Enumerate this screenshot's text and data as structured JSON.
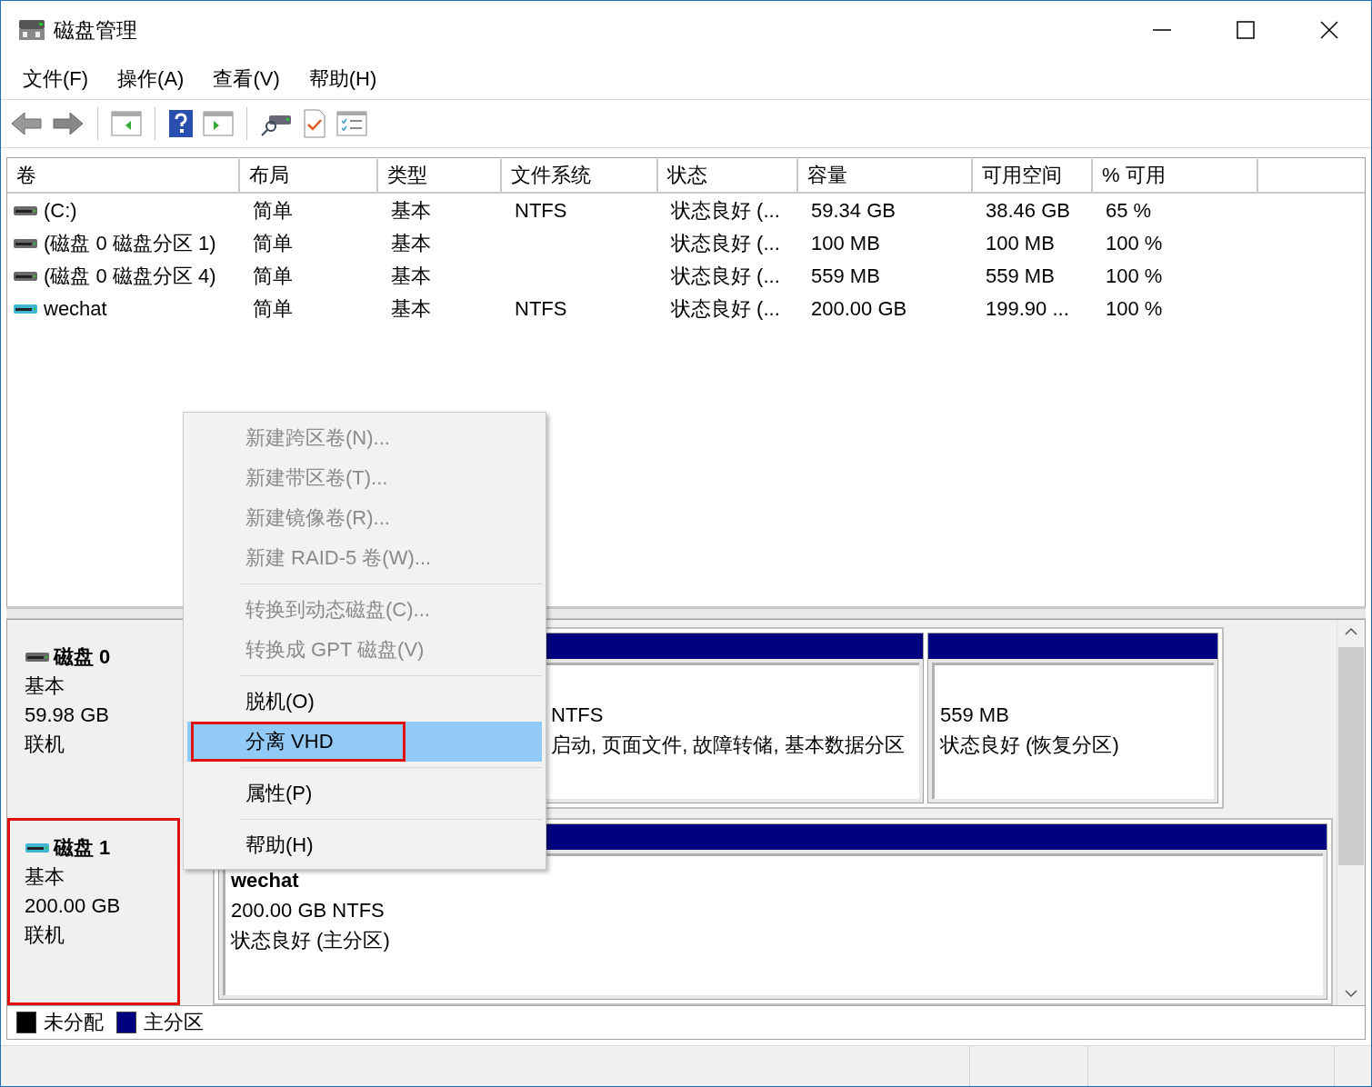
{
  "window": {
    "title": "磁盘管理"
  },
  "menu_bar": [
    "文件(F)",
    "操作(A)",
    "查看(V)",
    "帮助(H)"
  ],
  "volume_table": {
    "columns": [
      "卷",
      "布局",
      "类型",
      "文件系统",
      "状态",
      "容量",
      "可用空间",
      "% 可用"
    ],
    "rows": [
      {
        "kind": "physical",
        "cells": [
          "(C:)",
          "简单",
          "基本",
          "NTFS",
          "状态良好 (...",
          "59.34 GB",
          "38.46 GB",
          "65 %"
        ]
      },
      {
        "kind": "physical",
        "cells": [
          "(磁盘 0 磁盘分区 1)",
          "简单",
          "基本",
          "",
          "状态良好 (...",
          "100 MB",
          "100 MB",
          "100 %"
        ]
      },
      {
        "kind": "physical",
        "cells": [
          "(磁盘 0 磁盘分区 4)",
          "简单",
          "基本",
          "",
          "状态良好 (...",
          "559 MB",
          "559 MB",
          "100 %"
        ]
      },
      {
        "kind": "virtual",
        "cells": [
          "wechat",
          "简单",
          "基本",
          "NTFS",
          "状态良好 (...",
          "200.00 GB",
          "199.90 ...",
          "100 %"
        ]
      }
    ]
  },
  "disks": [
    {
      "kind": "physical",
      "name": "磁盘 0",
      "type": "基本",
      "size": "59.98 GB",
      "status": "联机",
      "outlined": false,
      "partitions": [
        {
          "lines": [
            "NTFS",
            "启动, 页面文件, 故障转储, 基本数据分区"
          ]
        },
        {
          "lines": [
            "559 MB",
            "状态良好 (恢复分区)"
          ]
        }
      ]
    },
    {
      "kind": "virtual",
      "name": "磁盘 1",
      "type": "基本",
      "size": "200.00 GB",
      "status": "联机",
      "outlined": true,
      "partitions": [
        {
          "title": "wechat",
          "lines": [
            "200.00 GB NTFS",
            "状态良好 (主分区)"
          ]
        }
      ]
    }
  ],
  "legend": [
    {
      "label": "未分配",
      "color": "#000000"
    },
    {
      "label": "主分区",
      "color": "#000080"
    }
  ],
  "context_menu": {
    "groups": [
      [
        {
          "label": "新建跨区卷(N)...",
          "disabled": true,
          "selected": false,
          "outlined": false
        },
        {
          "label": "新建带区卷(T)...",
          "disabled": true,
          "selected": false,
          "outlined": false
        },
        {
          "label": "新建镜像卷(R)...",
          "disabled": true,
          "selected": false,
          "outlined": false
        },
        {
          "label": "新建 RAID-5 卷(W)...",
          "disabled": true,
          "selected": false,
          "outlined": false
        }
      ],
      [
        {
          "label": "转换到动态磁盘(C)...",
          "disabled": true,
          "selected": false,
          "outlined": false
        },
        {
          "label": "转换成 GPT 磁盘(V)",
          "disabled": true,
          "selected": false,
          "outlined": false
        }
      ],
      [
        {
          "label": "脱机(O)",
          "disabled": false,
          "selected": false,
          "outlined": false
        },
        {
          "label": "分离 VHD",
          "disabled": false,
          "selected": true,
          "outlined": true
        }
      ],
      [
        {
          "label": "属性(P)",
          "disabled": false,
          "selected": false,
          "outlined": false
        }
      ],
      [
        {
          "label": "帮助(H)",
          "disabled": false,
          "selected": false,
          "outlined": false
        }
      ]
    ]
  }
}
